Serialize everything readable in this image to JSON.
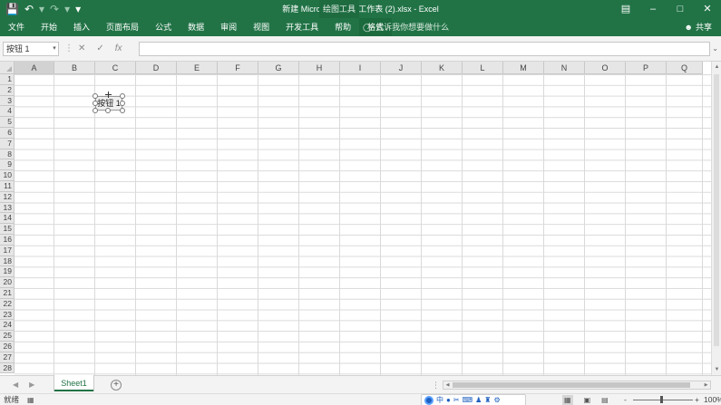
{
  "titlebar": {
    "title": "新建 Microsoft Excel 工作表 (2).xlsx  -  Excel",
    "contextual_tab": "绘图工具",
    "save_icon": "save-icon",
    "undo_icon": "undo-icon",
    "redo_icon": "redo-icon"
  },
  "ribbon": {
    "tabs": [
      {
        "label": "文件"
      },
      {
        "label": "开始"
      },
      {
        "label": "插入"
      },
      {
        "label": "页面布局"
      },
      {
        "label": "公式"
      },
      {
        "label": "数据"
      },
      {
        "label": "审阅"
      },
      {
        "label": "视图"
      },
      {
        "label": "开发工具"
      },
      {
        "label": "帮助"
      },
      {
        "label": "格式"
      }
    ],
    "active_tab": "格式",
    "tell_me": "告诉我你想要做什么",
    "share": "共享"
  },
  "formula_bar": {
    "name_box": "按钮 1",
    "cancel": "✕",
    "enter": "✓",
    "fx": "fx",
    "formula": ""
  },
  "grid": {
    "columns": [
      "A",
      "B",
      "C",
      "D",
      "E",
      "F",
      "G",
      "H",
      "I",
      "J",
      "K",
      "L",
      "M",
      "N",
      "O",
      "P",
      "Q"
    ],
    "rows": [
      "1",
      "2",
      "3",
      "4",
      "5",
      "6",
      "7",
      "8",
      "9",
      "10",
      "11",
      "12",
      "13",
      "14",
      "15",
      "16",
      "17",
      "18",
      "19",
      "20",
      "21",
      "22",
      "23",
      "24",
      "25",
      "26",
      "27",
      "28"
    ],
    "selected_column": "A"
  },
  "form_button": {
    "label": "按钮 1"
  },
  "sheets": {
    "tabs": [
      {
        "label": "Sheet1"
      }
    ],
    "add_label": "+"
  },
  "status_bar": {
    "ready": "就绪",
    "ime_lang": "中",
    "zoom": "100%",
    "zoom_minus": "-",
    "zoom_plus": "+"
  },
  "colors": {
    "excel_green": "#217346"
  }
}
